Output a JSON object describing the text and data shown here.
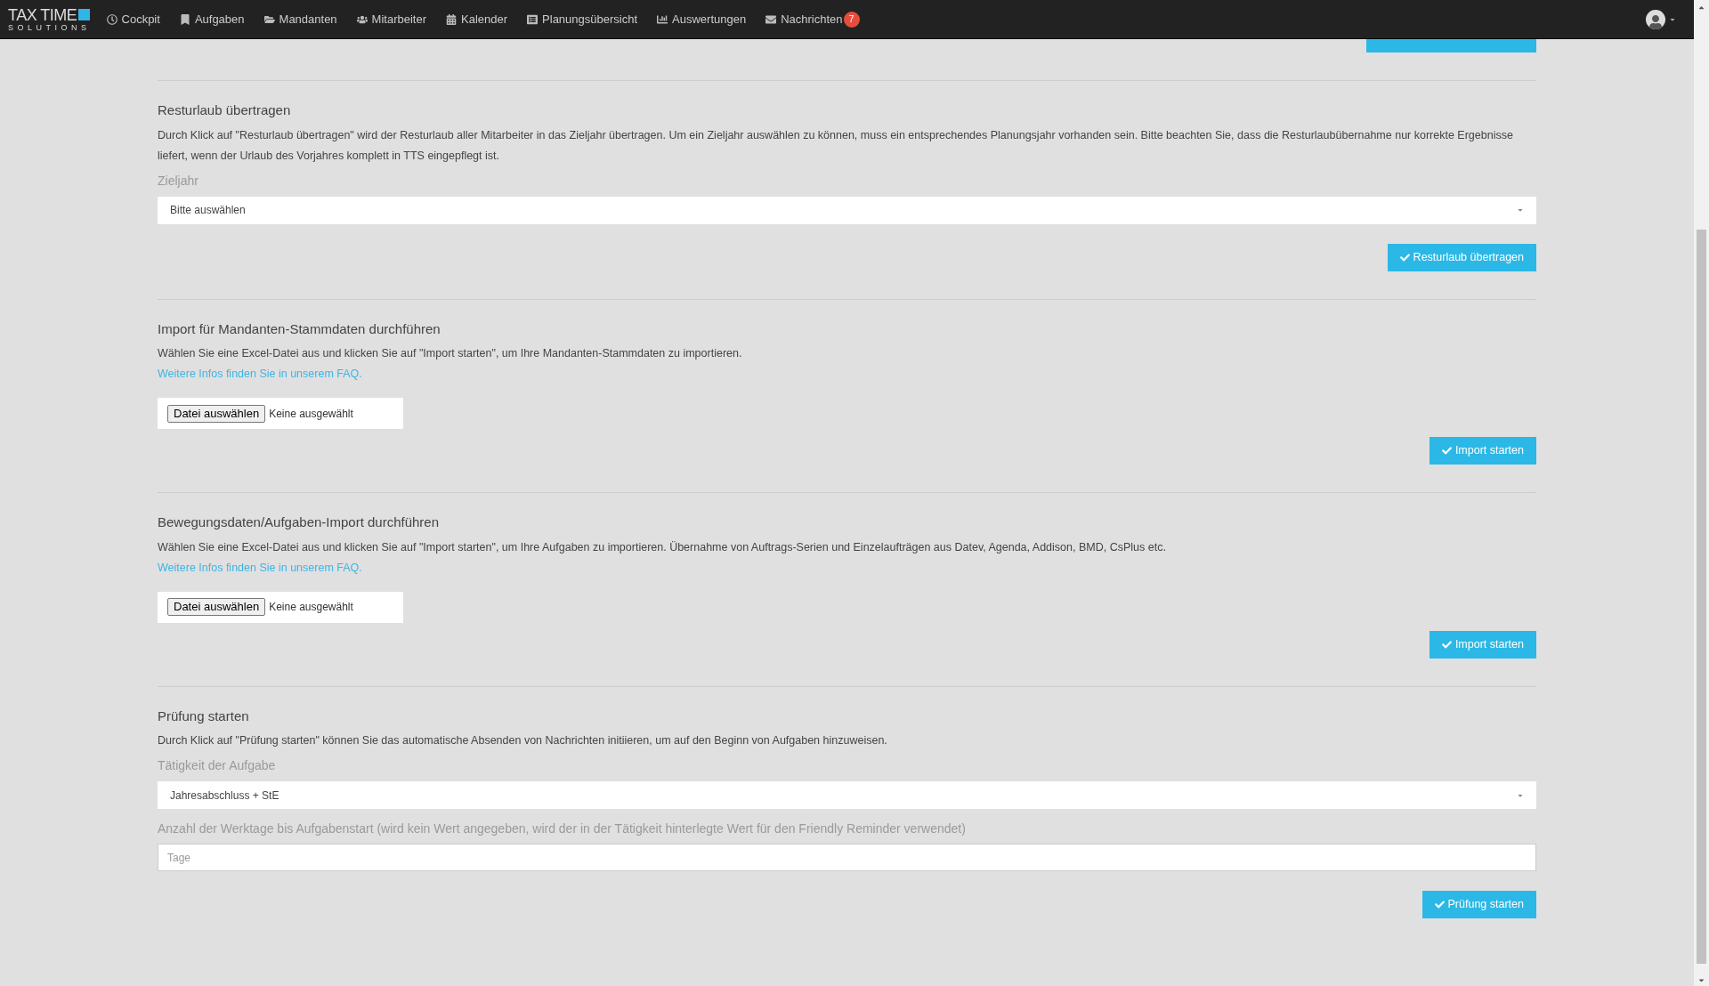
{
  "navbar": {
    "logo": {
      "title": "TAX TIME",
      "subtitle": "SOLUTIONS"
    },
    "items": [
      {
        "label": "Cockpit"
      },
      {
        "label": "Aufgaben"
      },
      {
        "label": "Mandanten"
      },
      {
        "label": "Mitarbeiter"
      },
      {
        "label": "Kalender"
      },
      {
        "label": "Planungsübersicht"
      },
      {
        "label": "Auswertungen"
      },
      {
        "label": "Nachrichten",
        "badge": "7"
      }
    ]
  },
  "sections": [
    {
      "title": "Resturlaub übertragen",
      "description": "Durch Klick auf \"Resturlaub übertragen\" wird der Resturlaub aller Mitarbeiter in das Zieljahr übertragen. Um ein Zieljahr auswählen zu können, muss ein entsprechendes Planungsjahr vorhanden sein. Bitte beachten Sie, dass die Resturlaubübernahme nur korrekte Ergebnisse liefert, wenn der Urlaub des Vorjahres komplett in TTS eingepflegt ist.",
      "fields": [
        {
          "kind": "select",
          "label": "Zieljahr",
          "value": "Bitte auswählen"
        }
      ],
      "button": "Resturlaub übertragen"
    },
    {
      "title": "Import für Mandanten-Stammdaten durchführen",
      "description": "Wählen Sie eine Excel-Datei aus und klicken Sie auf \"Import starten\", um Ihre Mandanten-Stammdaten zu importieren.",
      "link": "Weitere Infos finden Sie in unserem FAQ.",
      "fields": [
        {
          "kind": "file",
          "button": "Datei auswählen",
          "value": "Keine ausgewählt"
        }
      ],
      "button": "Import starten"
    },
    {
      "title": "Bewegungsdaten/Aufgaben-Import durchführen",
      "description": "Wählen Sie eine Excel-Datei aus und klicken Sie auf \"Import starten\", um Ihre Aufgaben zu importieren. Übernahme von Auftrags-Serien und Einzelaufträgen aus Datev, Agenda, Addison, BMD, CsPlus etc.",
      "link": "Weitere Infos finden Sie in unserem FAQ.",
      "fields": [
        {
          "kind": "file",
          "button": "Datei auswählen",
          "value": "Keine ausgewählt"
        }
      ],
      "button": "Import starten"
    },
    {
      "title": "Prüfung starten",
      "description": "Durch Klick auf \"Prüfung starten\" können Sie das automatische Absenden von Nachrichten initiieren, um auf den Beginn von Aufgaben hinzuweisen.",
      "fields": [
        {
          "kind": "select",
          "label": "Tätigkeit der Aufgabe",
          "value": "Jahresabschluss + StE"
        },
        {
          "kind": "text",
          "label": "Anzahl der Werktage bis Aufgabenstart (wird kein Wert angegeben, wird der in der Tätigkeit hinterlegte Wert für den Friendly Reminder verwendet)",
          "placeholder": "Tage"
        }
      ],
      "button": "Prüfung starten"
    }
  ]
}
